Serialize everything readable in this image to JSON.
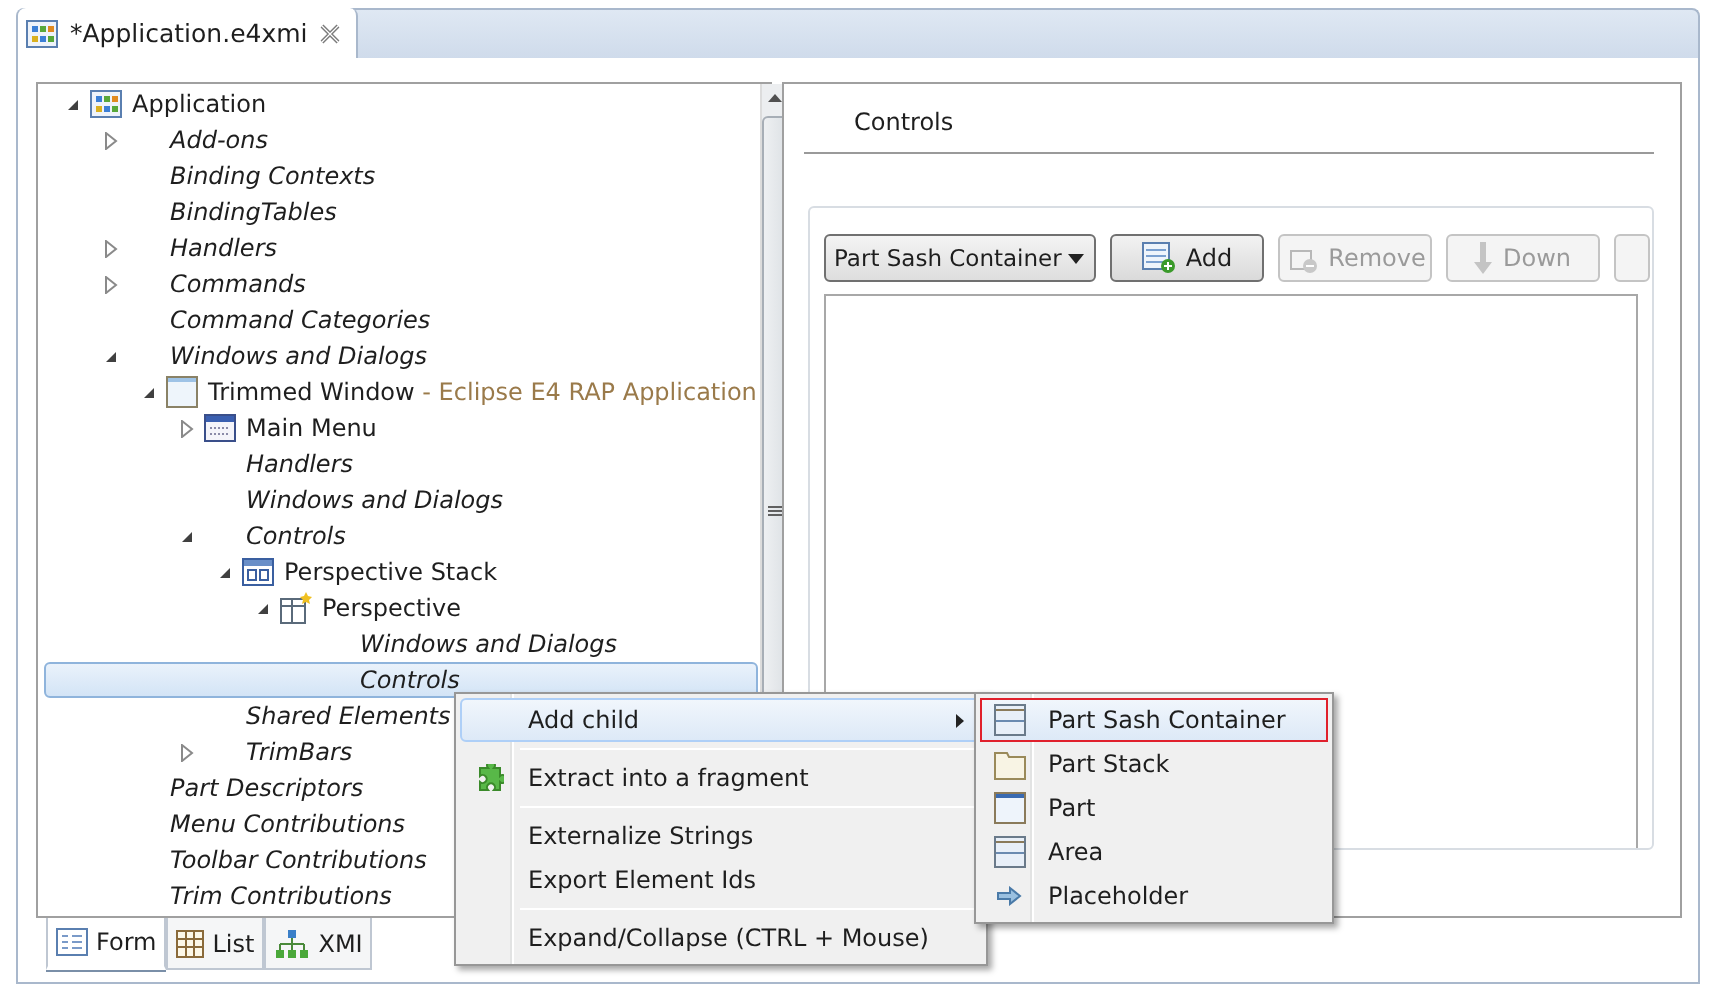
{
  "editor_tab": {
    "title": "*Application.e4xmi"
  },
  "tree": {
    "items": [
      {
        "label": "Application",
        "kind": "application",
        "expanded": true,
        "selected": false,
        "children": [
          {
            "label": "Add-ons",
            "kind": "folder",
            "expanded": false,
            "selected": false
          },
          {
            "label": "Binding Contexts",
            "kind": "folder",
            "selected": false
          },
          {
            "label": "BindingTables",
            "kind": "folder",
            "selected": false
          },
          {
            "label": "Handlers",
            "kind": "folder",
            "expanded": false,
            "selected": false
          },
          {
            "label": "Commands",
            "kind": "folder",
            "expanded": false,
            "selected": false
          },
          {
            "label": "Command Categories",
            "kind": "folder",
            "selected": false
          },
          {
            "label": "Windows and Dialogs",
            "kind": "folder",
            "expanded": true,
            "selected": false,
            "children": [
              {
                "label": "Trimmed Window",
                "detail": " - Eclipse E4 RAP Application",
                "kind": "window",
                "expanded": true,
                "selected": false,
                "children": [
                  {
                    "label": "Main Menu",
                    "kind": "menu",
                    "expanded": false,
                    "selected": false
                  },
                  {
                    "label": "Handlers",
                    "kind": "folder",
                    "selected": false
                  },
                  {
                    "label": "Windows and Dialogs",
                    "kind": "folder",
                    "selected": false
                  },
                  {
                    "label": "Controls",
                    "kind": "folder",
                    "expanded": true,
                    "selected": false,
                    "children": [
                      {
                        "label": "Perspective Stack",
                        "kind": "stack",
                        "expanded": true,
                        "selected": false,
                        "children": [
                          {
                            "label": "Perspective",
                            "kind": "perspective",
                            "expanded": true,
                            "selected": false,
                            "children": [
                              {
                                "label": "Windows and Dialogs",
                                "kind": "folder",
                                "selected": false
                              },
                              {
                                "label": "Controls",
                                "kind": "folder",
                                "selected": true
                              }
                            ]
                          }
                        ]
                      }
                    ]
                  },
                  {
                    "label": "Shared Elements",
                    "kind": "folder",
                    "selected": false
                  },
                  {
                    "label": "TrimBars",
                    "kind": "folder",
                    "expanded": false,
                    "selected": false
                  }
                ]
              }
            ]
          },
          {
            "label": "Part Descriptors",
            "kind": "folder",
            "selected": false
          },
          {
            "label": "Menu Contributions",
            "kind": "folder",
            "selected": false
          },
          {
            "label": "Toolbar Contributions",
            "kind": "folder",
            "selected": false
          },
          {
            "label": "Trim Contributions",
            "kind": "folder",
            "selected": false
          }
        ]
      }
    ]
  },
  "details": {
    "section_title": "Controls",
    "type_combo": {
      "value": "Part Sash Container"
    },
    "buttons": [
      {
        "label": "Add",
        "kind": "add",
        "disabled": false
      },
      {
        "label": "Remove",
        "kind": "remove",
        "disabled": true
      },
      {
        "label": "Down",
        "kind": "down",
        "disabled": true
      },
      {
        "kind": "blank",
        "disabled": true
      }
    ]
  },
  "bottom_tabs": [
    {
      "label": "Form",
      "kind": "form",
      "selected": true
    },
    {
      "label": "List",
      "kind": "list",
      "selected": false
    },
    {
      "label": "XMI",
      "kind": "xmi",
      "selected": false
    }
  ],
  "context_menu": {
    "groups": [
      [
        {
          "label": "Add child",
          "submenu": true,
          "selected": true
        }
      ],
      [
        {
          "label": "Extract into a fragment",
          "kind": "puzzle",
          "selected": false
        }
      ],
      [
        {
          "label": "Externalize Strings",
          "selected": false
        },
        {
          "label": "Export Element Ids",
          "selected": false
        }
      ],
      [
        {
          "label": "Expand/Collapse (CTRL + Mouse)",
          "selected": false
        }
      ]
    ]
  },
  "submenu": {
    "items": [
      {
        "label": "Part Sash Container",
        "kind": "sash",
        "selected": true
      },
      {
        "label": "Part Stack",
        "kind": "stack",
        "selected": false
      },
      {
        "label": "Part",
        "kind": "part",
        "selected": false
      },
      {
        "label": "Area",
        "kind": "area",
        "selected": false
      },
      {
        "label": "Placeholder",
        "kind": "placeholder",
        "selected": false
      }
    ]
  }
}
